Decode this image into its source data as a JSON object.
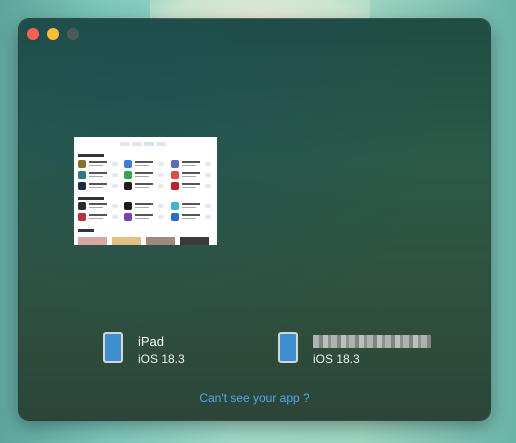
{
  "window": {
    "title": ""
  },
  "devices": [
    {
      "name": "iPad",
      "os": "iOS 18.3",
      "icon": "ipad-icon"
    },
    {
      "name": "",
      "os": "iOS 18.3",
      "icon": "ipad-icon",
      "name_redacted": true
    }
  ],
  "help": {
    "link_label": "Can't see your app ?"
  },
  "colors": {
    "accent_link": "#4fa8f0",
    "close": "#fe5f57",
    "minimize": "#febc2e"
  }
}
